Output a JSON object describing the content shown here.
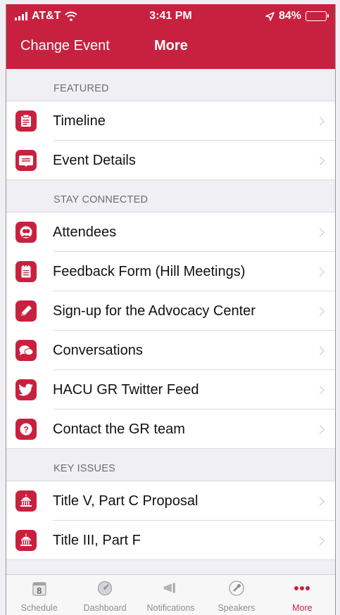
{
  "status": {
    "carrier": "AT&T",
    "time": "3:41 PM",
    "battery": "84%",
    "battery_level": 0.84
  },
  "nav": {
    "back_label": "Change Event",
    "title": "More"
  },
  "sections": [
    {
      "header": "FEATURED",
      "items": [
        {
          "label": "Timeline",
          "icon": "timeline-icon"
        },
        {
          "label": "Event Details",
          "icon": "event-details-icon"
        }
      ]
    },
    {
      "header": "STAY CONNECTED",
      "items": [
        {
          "label": "Attendees",
          "icon": "attendees-icon"
        },
        {
          "label": "Feedback Form (Hill Meetings)",
          "icon": "notepad-icon"
        },
        {
          "label": "Sign-up for the Advocacy Center",
          "icon": "pencil-icon"
        },
        {
          "label": "Conversations",
          "icon": "chat-bubbles-icon"
        },
        {
          "label": "HACU GR Twitter Feed",
          "icon": "twitter-icon"
        },
        {
          "label": "Contact the GR team",
          "icon": "question-icon"
        }
      ]
    },
    {
      "header": "KEY ISSUES",
      "items": [
        {
          "label": "Title V, Part C Proposal",
          "icon": "capitol-icon"
        },
        {
          "label": "Title III, Part F",
          "icon": "capitol-icon"
        }
      ]
    }
  ],
  "tabbar": {
    "tabs": [
      {
        "label": "Schedule",
        "icon": "calendar-icon",
        "badge": "8"
      },
      {
        "label": "Dashboard",
        "icon": "dashboard-icon"
      },
      {
        "label": "Notifications",
        "icon": "megaphone-icon"
      },
      {
        "label": "Speakers",
        "icon": "microphone-icon"
      },
      {
        "label": "More",
        "icon": "more-dots-icon"
      }
    ],
    "active": "More"
  },
  "colors": {
    "accent": "#c8213f",
    "background": "#efeff4",
    "inactive_tab": "#8e8e93"
  }
}
